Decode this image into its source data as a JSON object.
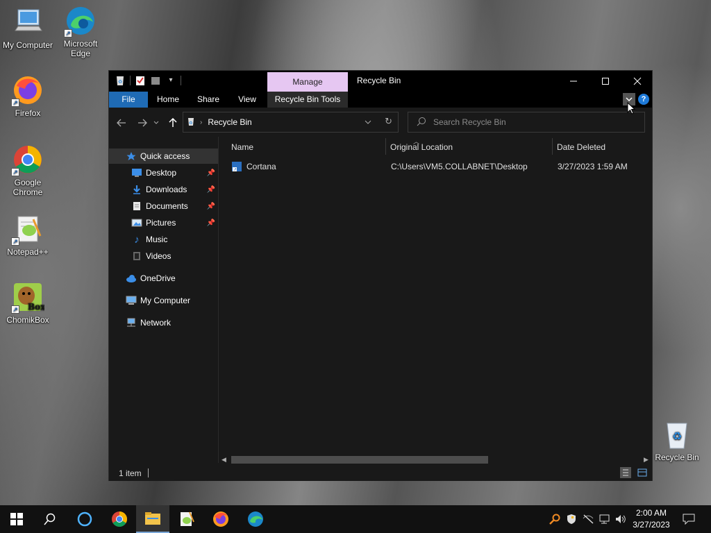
{
  "desktop": {
    "icons": [
      {
        "label": "My Computer"
      },
      {
        "label": "Microsoft Edge"
      },
      {
        "label": "Firefox"
      },
      {
        "label": "Google Chrome"
      },
      {
        "label": "Notepad++"
      },
      {
        "label": "ChomikBox"
      },
      {
        "label": "Recycle Bin"
      }
    ]
  },
  "window": {
    "title": "Recycle Bin",
    "contextual_tab": "Manage",
    "ribbon_tabs": [
      "File",
      "Home",
      "Share",
      "View",
      "Recycle Bin Tools"
    ],
    "address": {
      "crumb": "Recycle Bin"
    },
    "search": {
      "placeholder": "Search Recycle Bin",
      "value": ""
    },
    "nav_pane": {
      "items": [
        {
          "label": "Quick access",
          "icon": "star-icon"
        },
        {
          "label": "Desktop",
          "icon": "desktop-icon",
          "pinned": true
        },
        {
          "label": "Downloads",
          "icon": "download-icon",
          "pinned": true
        },
        {
          "label": "Documents",
          "icon": "document-icon",
          "pinned": true
        },
        {
          "label": "Pictures",
          "icon": "pictures-icon",
          "pinned": true
        },
        {
          "label": "Music",
          "icon": "music-icon"
        },
        {
          "label": "Videos",
          "icon": "video-icon"
        },
        {
          "label": "OneDrive",
          "icon": "cloud-icon"
        },
        {
          "label": "My Computer",
          "icon": "computer-icon"
        },
        {
          "label": "Network",
          "icon": "network-icon"
        }
      ]
    },
    "columns": [
      "Name",
      "Original Location",
      "Date Deleted"
    ],
    "files": [
      {
        "name": "Cortana",
        "original_location": "C:\\Users\\VM5.COLLABNET\\Desktop",
        "date_deleted": "3/27/2023 1:59 AM"
      }
    ],
    "status": {
      "item_count": "1 item"
    }
  },
  "taskbar": {
    "time": "2:00 AM",
    "date": "3/27/2023"
  },
  "colors": {
    "accent": "#1f6bb5",
    "manage_tab": "#e6c7f2",
    "window_bg": "#191919",
    "taskbar": "#111111"
  }
}
